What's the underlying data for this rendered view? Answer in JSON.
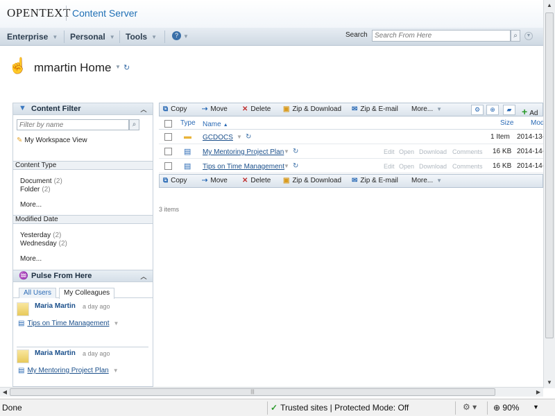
{
  "header": {
    "logo": "OPENTEXT",
    "product": "Content Server"
  },
  "nav": {
    "items": [
      "Enterprise",
      "Personal",
      "Tools"
    ],
    "search_label": "Search",
    "search_placeholder": "Search From Here"
  },
  "home": {
    "title": "mmartin Home"
  },
  "filter_panel": {
    "title": "Content Filter",
    "filter_placeholder": "Filter by name",
    "workspace_view": "My Workspace View",
    "content_type": {
      "heading": "Content Type",
      "items": [
        {
          "label": "Document",
          "count": "(2)"
        },
        {
          "label": "Folder",
          "count": "(2)"
        }
      ],
      "more": "More..."
    },
    "modified_date": {
      "heading": "Modified Date",
      "items": [
        {
          "label": "Yesterday",
          "count": "(2)"
        },
        {
          "label": "Wednesday",
          "count": "(2)"
        }
      ],
      "more": "More..."
    }
  },
  "pulse_panel": {
    "title": "Pulse From Here",
    "tabs": [
      "All Users",
      "My Colleagues"
    ],
    "entries": [
      {
        "user": "Maria Martin",
        "time": "a day ago",
        "link": "Tips on Time Management"
      },
      {
        "user": "Maria Martin",
        "time": "a day ago",
        "link": "My Mentoring Project Plan"
      }
    ]
  },
  "toolbar": {
    "copy": "Copy",
    "move": "Move",
    "delete": "Delete",
    "zip_download": "Zip & Download",
    "zip_email": "Zip & E-mail",
    "more": "More...",
    "add": "Ad"
  },
  "table": {
    "columns": {
      "type": "Type",
      "name": "Name",
      "size": "Size",
      "modified": "Mod"
    },
    "rows": [
      {
        "name": "GCDOCS",
        "icon": "folder",
        "size": "1 Item",
        "modified": "2014-13-",
        "actions": []
      },
      {
        "name": "My Mentoring Project Plan",
        "icon": "document",
        "size": "16 KB",
        "modified": "2014-14-",
        "actions": [
          "Edit",
          "Open",
          "Download",
          "Comments"
        ]
      },
      {
        "name": "Tips on Time Management",
        "icon": "document",
        "size": "16 KB",
        "modified": "2014-14-",
        "actions": [
          "Edit",
          "Open",
          "Download",
          "Comments"
        ]
      }
    ],
    "item_count": "3 items"
  },
  "statusbar": {
    "status": "Done",
    "zone": "Trusted sites | Protected Mode: Off",
    "zoom": "90%"
  },
  "colors": {
    "accent": "#1f6fb5",
    "link": "#1a4f8b",
    "trusted_check": "#2a9a2a"
  }
}
